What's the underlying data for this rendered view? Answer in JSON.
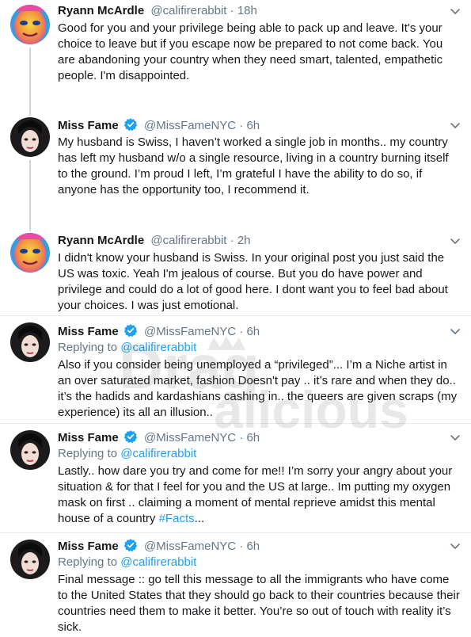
{
  "tweets": [
    {
      "name": "Ryann McArdle",
      "handle": "@califirerabbit",
      "separator": "·",
      "time": "18h",
      "verified": false,
      "replying_prefix": "",
      "replying_to": "",
      "text": "Good for you and your privilege being able to pack up and leave. It's your choice to leave but if you escape now be prepared to not come back. You are abandoning your country when they need smart, talented, empathetic people. I'm disappointed.",
      "hashtag": ""
    },
    {
      "name": "Miss Fame",
      "handle": "@MissFameNYC",
      "separator": "·",
      "time": "6h",
      "verified": true,
      "replying_prefix": "",
      "replying_to": "",
      "text": "My husband is Swiss, I haven’t worked a single job in months.. my country has left my husband w/o a single resource, living in a country burning itself to the ground. I’m proud I left, I’m grateful I have the ability to do so, if anyone has the opportunity too, I recommend it.",
      "hashtag": ""
    },
    {
      "name": "Ryann McArdle",
      "handle": "@califirerabbit",
      "separator": "·",
      "time": "2h",
      "verified": false,
      "replying_prefix": "",
      "replying_to": "",
      "text": "I didn't know your husband is Swiss. In your original post you just said the US was toxic. Yeah I'm jealous of course. But you do have power and privilege and could do a lot of good here. I dont want you to feel bad about your choices. I was just emotional.",
      "hashtag": ""
    },
    {
      "name": "Miss Fame",
      "handle": "@MissFameNYC",
      "separator": "·",
      "time": "6h",
      "verified": true,
      "replying_prefix": "Replying to",
      "replying_to": "@califirerabbit",
      "text": "Also if you consider being unemployed a “privileged”... I’m a Niche artist in an over saturated market, fashion Doesn't pay .. it’s rare and when they do.. it’s the hadids and kardashians cashing in.. the queers are given scraps (my experience) its all an illusion..",
      "hashtag": ""
    },
    {
      "name": "Miss Fame",
      "handle": "@MissFameNYC",
      "separator": "·",
      "time": "6h",
      "verified": true,
      "replying_prefix": "Replying to",
      "replying_to": "@califirerabbit",
      "text": "Lastly.. how dare you try and come for me!! I’m sorry your angry about your situation & for that I feel for you and the US at large.. Im putting my oxygen mask on first .. claiming a moment of mental reprieve amidst this mental house of a country ",
      "hashtag": "#Facts",
      "suffix": "..."
    },
    {
      "name": "Miss Fame",
      "handle": "@MissFameNYC",
      "separator": "·",
      "time": "6h",
      "verified": true,
      "replying_prefix": "Replying to",
      "replying_to": "@califirerabbit",
      "text": "Final message :: go tell this message to all the immigrants who have come to the United States that they should go back to their countries because their countries need them to make it better. You’re so out of touch with reality it’s sick.",
      "hashtag": ""
    }
  ],
  "watermark": {
    "line1": "Drag",
    "line2": "alicious"
  },
  "colors": {
    "link": "#1da1f2",
    "muted": "#657786",
    "text": "#14171a",
    "verified": "#1da1f2",
    "thread_line": "#ccd6dd"
  },
  "icons": {
    "verified": "verified-badge-icon",
    "more": "chevron-down-icon"
  }
}
